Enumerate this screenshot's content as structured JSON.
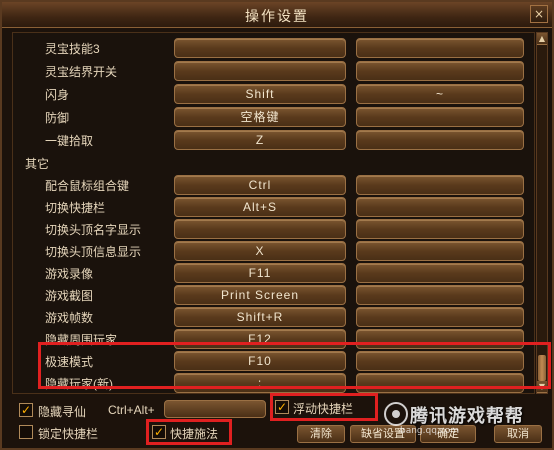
{
  "window": {
    "title": "操作设置",
    "close_label": "×"
  },
  "rows": [
    {
      "label": "灵宝技能3",
      "key1": "",
      "key2": "",
      "section": false
    },
    {
      "label": "灵宝结界开关",
      "key1": "",
      "key2": "",
      "section": false
    },
    {
      "label": "闪身",
      "key1": "Shift",
      "key2": "~",
      "section": false
    },
    {
      "label": "防御",
      "key1": "空格键",
      "key2": "",
      "section": false
    },
    {
      "label": "一键拾取",
      "key1": "Z",
      "key2": "",
      "section": false
    },
    {
      "label": "其它",
      "section": true
    },
    {
      "label": "配合鼠标组合键",
      "key1": "Ctrl",
      "key2": "",
      "section": false
    },
    {
      "label": "切换快捷栏",
      "key1": "Alt+S",
      "key2": "",
      "section": false
    },
    {
      "label": "切换头顶名字显示",
      "key1": "",
      "key2": "",
      "section": false
    },
    {
      "label": "切换头顶信息显示",
      "key1": "X",
      "key2": "",
      "section": false
    },
    {
      "label": "游戏录像",
      "key1": "F11",
      "key2": "",
      "section": false
    },
    {
      "label": "游戏截图",
      "key1": "Print Screen",
      "key2": "",
      "section": false
    },
    {
      "label": "游戏帧数",
      "key1": "Shift+R",
      "key2": "",
      "section": false
    },
    {
      "label": "隐藏周围玩家",
      "key1": "F12",
      "key2": "",
      "section": false
    },
    {
      "label": "极速模式",
      "key1": "F10",
      "key2": "",
      "section": false
    },
    {
      "label": "隐藏玩家(新)",
      "key1": ";",
      "key2": "",
      "section": false
    }
  ],
  "options": {
    "hide_immortal": {
      "label": "隐藏寻仙",
      "checked": true,
      "mark": "✓"
    },
    "combo_prefix": "Ctrl+Alt+",
    "floating_shortcut": {
      "label": "浮动快捷栏",
      "checked": true,
      "mark": "✓"
    },
    "lock_shortcut": {
      "label": "锁定快捷栏",
      "checked": false,
      "mark": ""
    },
    "quick_cast": {
      "label": "快捷施法",
      "checked": true,
      "mark": "✓"
    }
  },
  "buttons": {
    "clear": "清除",
    "default": "缺省设置",
    "confirm": "确定",
    "cancel": "取消"
  },
  "watermark": {
    "text": "腾讯游戏帮帮",
    "url": "bang.qq.com"
  },
  "colors": {
    "highlight": "#e02020",
    "accent": "#ffb000"
  }
}
